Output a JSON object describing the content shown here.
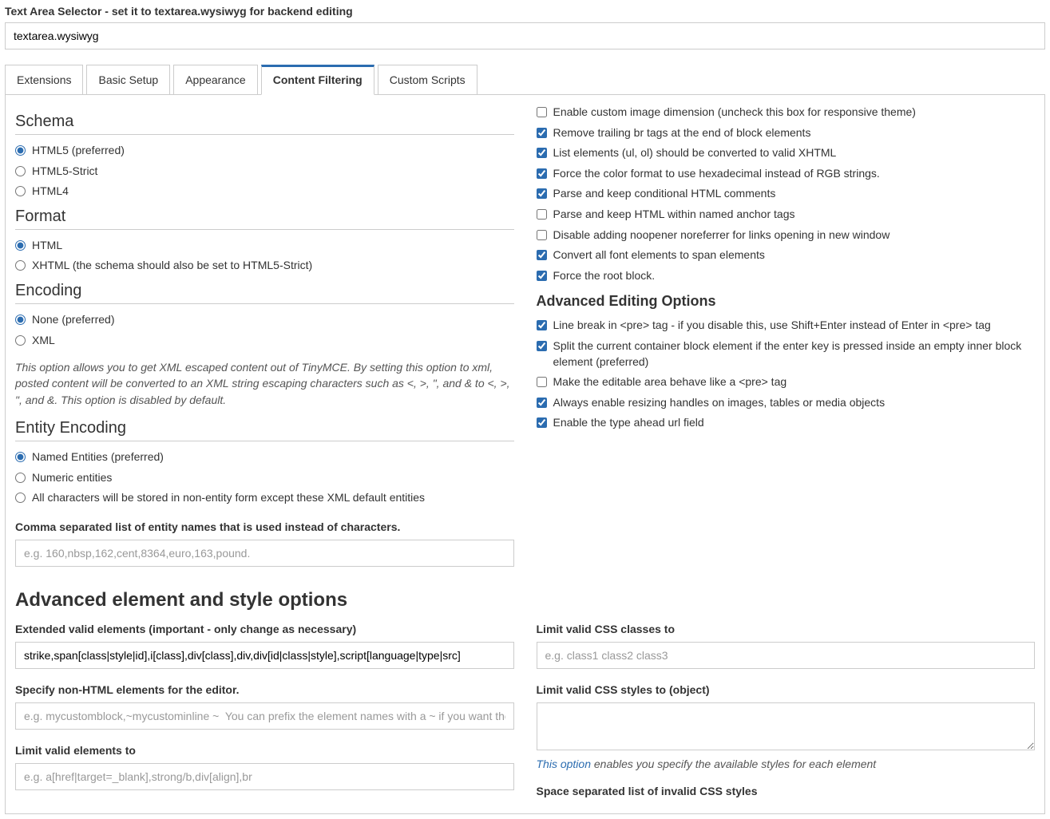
{
  "topField": {
    "label": "Text Area Selector - set it to textarea.wysiwyg for backend editing",
    "value": "textarea.wysiwyg"
  },
  "tabs": [
    "Extensions",
    "Basic Setup",
    "Appearance",
    "Content Filtering",
    "Custom Scripts"
  ],
  "activeTab": "Content Filtering",
  "leftCol": {
    "schema": {
      "heading": "Schema",
      "options": [
        "HTML5 (preferred)",
        "HTML5-Strict",
        "HTML4"
      ],
      "selected": 0
    },
    "format": {
      "heading": "Format",
      "options": [
        "HTML",
        "XHTML (the schema should also be set to HTML5-Strict)"
      ],
      "selected": 0
    },
    "encoding": {
      "heading": "Encoding",
      "options": [
        "None (preferred)",
        "XML"
      ],
      "selected": 0,
      "help": "This option allows you to get XML escaped content out of TinyMCE. By setting this option to xml, posted content will be converted to an XML string escaping characters such as <, >, \", and & to <, >, \", and &. This option is disabled by default."
    },
    "entityEncoding": {
      "heading": "Entity Encoding",
      "options": [
        "Named Entities (preferred)",
        "Numeric entities",
        "All characters will be stored in non-entity form except these XML default entities"
      ],
      "selected": 0,
      "listLabel": "Comma separated list of entity names that is used instead of characters.",
      "listPlaceholder": "e.g. 160,nbsp,162,cent,8364,euro,163,pound."
    }
  },
  "rightCol": {
    "checks": [
      {
        "label": "Enable custom image dimension (uncheck this box for responsive theme)",
        "checked": false
      },
      {
        "label": "Remove trailing br tags at the end of block elements",
        "checked": true
      },
      {
        "label": "List elements (ul, ol) should be converted to valid XHTML",
        "checked": true
      },
      {
        "label": "Force the color format to use hexadecimal instead of RGB strings.",
        "checked": true
      },
      {
        "label": "Parse and keep conditional HTML comments",
        "checked": true
      },
      {
        "label": "Parse and keep HTML within named anchor tags",
        "checked": false
      },
      {
        "label": "Disable adding noopener noreferrer for links opening in new window",
        "checked": false
      },
      {
        "label": "Convert all font elements to span elements",
        "checked": true
      },
      {
        "label": "Force the root block.",
        "checked": true
      }
    ],
    "advHeading": "Advanced Editing Options",
    "advChecks": [
      {
        "label": "Line break in <pre> tag - if you disable this, use Shift+Enter instead of Enter in <pre> tag",
        "checked": true
      },
      {
        "label": "Split the current container block element if the enter key is pressed inside an empty inner block element (preferred)",
        "checked": true
      },
      {
        "label": "Make the editable area behave like a <pre> tag",
        "checked": false
      },
      {
        "label": "Always enable resizing handles on images, tables or media objects",
        "checked": true
      },
      {
        "label": "Enable the type ahead url field",
        "checked": true
      }
    ]
  },
  "advSection": {
    "heading": "Advanced element and style options",
    "left": {
      "f1label": "Extended valid elements (important - only change as necessary)",
      "f1value": "strike,span[class|style|id],i[class],div[class],div,div[id|class|style],script[language|type|src]",
      "f2label": "Specify non-HTML elements for the editor.",
      "f2placeholder": "e.g. mycustomblock,~mycustominline ~  You can prefix the element names with a ~ if you want the element to behave as a span element.",
      "f3label": "Limit valid elements to",
      "f3placeholder": "e.g. a[href|target=_blank],strong/b,div[align],br"
    },
    "right": {
      "f1label": "Limit valid CSS classes to",
      "f1placeholder": "e.g. class1 class2 class3",
      "f2label": "Limit valid CSS styles to (object)",
      "noteLink": "This option",
      "noteRest": " enables you specify the available styles for each element",
      "f3label": "Space separated list of invalid CSS styles"
    }
  }
}
